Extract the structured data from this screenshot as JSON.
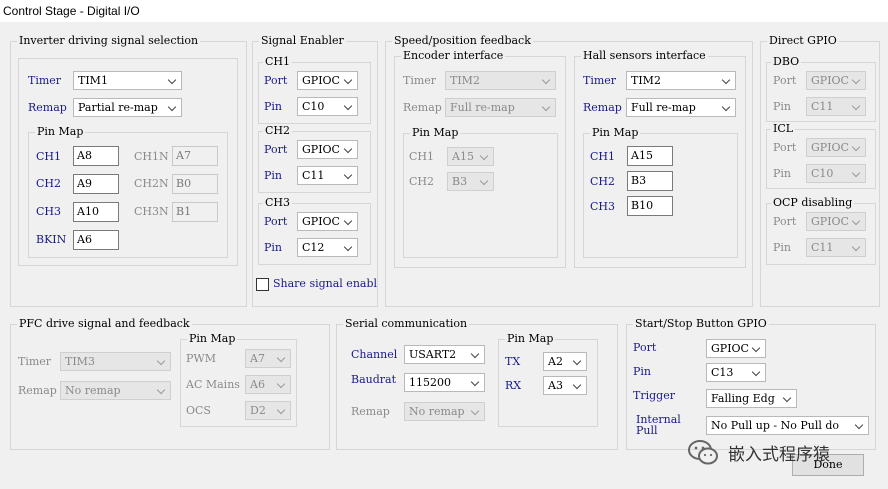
{
  "window": {
    "title": "Control Stage - Digital I/O"
  },
  "inverter": {
    "caption": "Inverter driving signal selection",
    "timer_label": "Timer",
    "timer_value": "TIM1",
    "remap_label": "Remap",
    "remap_value": "Partial re-map",
    "pinmap_caption": "Pin Map",
    "ch1_label": "CH1",
    "ch1_value": "A8",
    "ch2_label": "CH2",
    "ch2_value": "A9",
    "ch3_label": "CH3",
    "ch3_value": "A10",
    "bkin_label": "BKIN",
    "bkin_value": "A6",
    "ch1n_label": "CH1N",
    "ch1n_value": "A7",
    "ch2n_label": "CH2N",
    "ch2n_value": "B0",
    "ch3n_label": "CH3N",
    "ch3n_value": "B1"
  },
  "signal_enabler": {
    "caption": "Signal Enabler",
    "ch1_caption": "CH1",
    "ch1_port_label": "Port",
    "ch1_port_value": "GPIOC",
    "ch1_pin_label": "Pin",
    "ch1_pin_value": "C10",
    "ch2_caption": "CH2",
    "ch2_port_label": "Port",
    "ch2_port_value": "GPIOC",
    "ch2_pin_label": "Pin",
    "ch2_pin_value": "C11",
    "ch3_caption": "CH3",
    "ch3_port_label": "Port",
    "ch3_port_value": "GPIOC",
    "ch3_pin_label": "Pin",
    "ch3_pin_value": "C12",
    "share_label": "Share signal enabl"
  },
  "speed_feedback": {
    "caption": "Speed/position feedback",
    "encoder": {
      "caption": "Encoder interface",
      "timer_label": "Timer",
      "timer_value": "TIM2",
      "remap_label": "Remap",
      "remap_value": "Full re-map",
      "pinmap_caption": "Pin Map",
      "ch1_label": "CH1",
      "ch1_value": "A15",
      "ch2_label": "CH2",
      "ch2_value": "B3"
    },
    "hall": {
      "caption": "Hall sensors interface",
      "timer_label": "Timer",
      "timer_value": "TIM2",
      "remap_label": "Remap",
      "remap_value": "Full re-map",
      "pinmap_caption": "Pin Map",
      "ch1_label": "CH1",
      "ch1_value": "A15",
      "ch2_label": "CH2",
      "ch2_value": "B3",
      "ch3_label": "CH3",
      "ch3_value": "B10"
    }
  },
  "direct_gpio": {
    "caption": "Direct GPIO",
    "dbo_caption": "DBO",
    "dbo_port_label": "Port",
    "dbo_port_value": "GPIOC",
    "dbo_pin_label": "Pin",
    "dbo_pin_value": "C11",
    "icl_caption": "ICL",
    "icl_port_label": "Port",
    "icl_port_value": "GPIOC",
    "icl_pin_label": "Pin",
    "icl_pin_value": "C10",
    "ocp_caption": "OCP disabling",
    "ocp_port_label": "Port",
    "ocp_port_value": "GPIOC",
    "ocp_pin_label": "Pin",
    "ocp_pin_value": "C11"
  },
  "pfc": {
    "caption": "PFC drive signal and feedback",
    "timer_label": "Timer",
    "timer_value": "TIM3",
    "remap_label": "Remap",
    "remap_value": "No remap",
    "pinmap_caption": "Pin Map",
    "pwm_label": "PWM",
    "pwm_value": "A7",
    "acmains_label": "AC Mains",
    "acmains_value": "A6",
    "ocs_label": "OCS",
    "ocs_value": "D2"
  },
  "serial": {
    "caption": "Serial communication",
    "channel_label": "Channel",
    "channel_value": "USART2",
    "baudrate_label": "Baudrat",
    "baudrate_value": "115200",
    "remap_label": "Remap",
    "remap_value": "No remap",
    "pinmap_caption": "Pin Map",
    "tx_label": "TX",
    "tx_value": "A2",
    "rx_label": "RX",
    "rx_value": "A3"
  },
  "startstop": {
    "caption": "Start/Stop Button GPIO",
    "port_label": "Port",
    "port_value": "GPIOC",
    "pin_label": "Pin",
    "pin_value": "C13",
    "trigger_label": "Trigger",
    "trigger_value": "Falling Edg",
    "internal_label_1": "Internal",
    "internal_label_2": "Pull",
    "internal_value": "No Pull up - No Pull do"
  },
  "done_label": "Done",
  "watermark": "嵌入式程序猿"
}
